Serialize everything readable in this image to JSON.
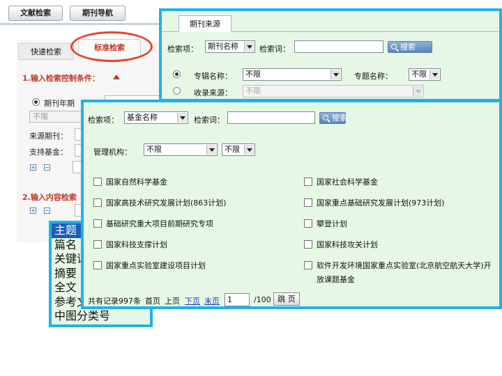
{
  "top_tabs": [
    "文献检索",
    "期刊导航"
  ],
  "bg": {
    "tab_quick": "快速检索",
    "tab_standard": "标准检索",
    "step1": "1.输入检索控制条件：",
    "radio_journal_year": "期刊年期",
    "year_placeholder": "不限",
    "source_journal_label": "来源期刊：",
    "fund_label": "支持基金：",
    "step2": "2.输入内容检索"
  },
  "subject_list": [
    "主题",
    "篇名",
    "关键词",
    "摘要",
    "全文",
    "参考文献",
    "中图分类号"
  ],
  "panel1": {
    "tab": "期刊来源",
    "search_field_label": "检索项：",
    "search_field_value": "期刊名称",
    "search_word_label": "检索词：",
    "search_button": "搜索",
    "radio1_label": "专辑名称：",
    "radio1_value": "不限",
    "topic_label": "专题名称：",
    "topic_value": "不限",
    "radio2_label": "收录来源：",
    "radio2_value": "不限"
  },
  "panel2": {
    "search_field_label": "检索项：",
    "search_field_value": "基金名称",
    "search_word_label": "检索词：",
    "search_button": "搜索",
    "agency_label": "管理机构：",
    "agency_value1": "不限",
    "agency_value2": "不限",
    "funds_left": [
      "国家自然科学基金",
      "国家高技术研究发展计划(863计划)",
      "基础研究重大项目前期研究专项",
      "国家科技支撑计划",
      "国家重点实验室建设项目计划"
    ],
    "funds_right": [
      "国家社会科学基金",
      "国家重点基础研究发展计划(973计划)",
      "攀登计划",
      "国家科技攻关计划",
      "软件开发环境国家重点实验室(北京航空航天大学)开",
      "放课题基金"
    ],
    "pagination": {
      "total": "共有记录997条",
      "first": "首页",
      "prev": "上页",
      "next": "下页",
      "last": "末页",
      "page_value": "1",
      "page_total": "/100",
      "go": "跳 页"
    }
  },
  "colors": {
    "panel_border": "#1fb3e8",
    "panel_bg": "#e7f7e6",
    "highlight_oval": "#e8452a",
    "accent_red": "#c0392b",
    "selected_item": "#1a5fb4"
  }
}
